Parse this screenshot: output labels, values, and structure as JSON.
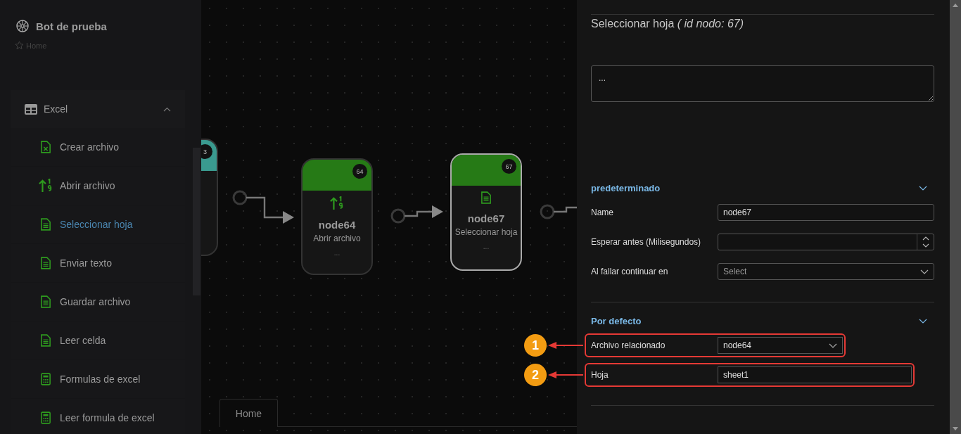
{
  "sidebar": {
    "title": "Bot de prueba",
    "breadcrumb": "Home",
    "group": {
      "label": "Excel",
      "expanded": true,
      "items": [
        {
          "label": "Crear archivo",
          "kind": "excel-file",
          "selected": false
        },
        {
          "label": "Abrir archivo",
          "kind": "sort",
          "selected": false
        },
        {
          "label": "Seleccionar hoja",
          "kind": "document",
          "selected": true
        },
        {
          "label": "Enviar texto",
          "kind": "document",
          "selected": false
        },
        {
          "label": "Guardar archivo",
          "kind": "document",
          "selected": false
        },
        {
          "label": "Leer celda",
          "kind": "document",
          "selected": false
        },
        {
          "label": "Formulas de excel",
          "kind": "calculator",
          "selected": false
        },
        {
          "label": "Leer formula de excel",
          "kind": "calculator",
          "selected": false
        }
      ]
    }
  },
  "canvas": {
    "nodes": [
      {
        "badge": "3",
        "kind": "partial",
        "color": "#3a9a8f",
        "selected": false
      },
      {
        "badge": "64",
        "title": "node64",
        "subtitle": "Abrir archivo",
        "more": "...",
        "kind": "sort",
        "color": "#267a16",
        "selected": false
      },
      {
        "badge": "67",
        "title": "node67",
        "subtitle": "Seleccionar hoja",
        "more": "...",
        "kind": "document",
        "color": "#267a16",
        "selected": true
      }
    ],
    "tabs": [
      {
        "label": "Home"
      }
    ]
  },
  "panel": {
    "title": "Seleccionar hoja *( id nodo: 67)*",
    "description": "...",
    "sections": [
      {
        "title": "predeterminado",
        "expanded": true,
        "fields": [
          {
            "label": "Name",
            "kind": "text",
            "value": "node67"
          },
          {
            "label": "Esperar antes (Milisegundos)",
            "kind": "number"
          },
          {
            "label": "Al fallar continuar en",
            "kind": "select",
            "placeholder": "Select"
          }
        ]
      },
      {
        "title": "Por defecto",
        "expanded": true,
        "fields": [
          {
            "label": "Archivo relacionado",
            "kind": "select",
            "value": "node64",
            "callout": "1"
          },
          {
            "label": "Hoja",
            "kind": "text",
            "value": "sheet1",
            "callout": "2"
          }
        ]
      }
    ]
  }
}
